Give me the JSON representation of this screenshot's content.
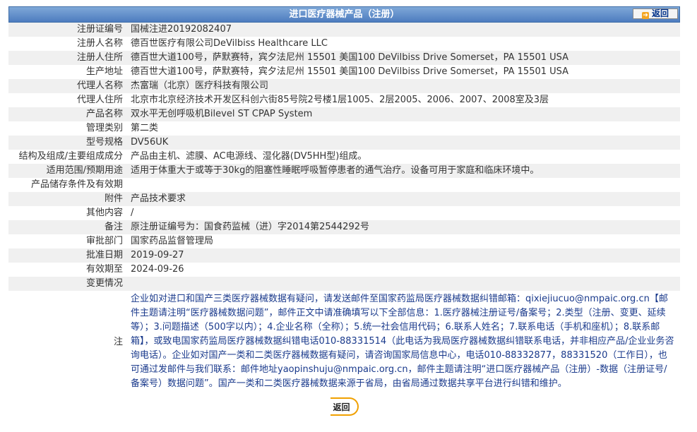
{
  "header": {
    "title": "进口医疗器械产品（注册）",
    "back_label": "返回"
  },
  "rows": [
    {
      "label": "注册证编号",
      "value": "国械注进20192082407"
    },
    {
      "label": "注册人名称",
      "value": "德百世医疗有限公司DeVilbiss Healthcare LLC"
    },
    {
      "label": "注册人住所",
      "value": "德百世大道100号，萨默赛特，宾夕法尼州 15501 美国100 DeVilbiss Drive Somerset，PA 15501 USA"
    },
    {
      "label": "生产地址",
      "value": "德百世大道100号，萨默赛特，宾夕法尼州 15501 美国100 DeVilbiss Drive Somerset，PA 15501 USA"
    },
    {
      "label": "代理人名称",
      "value": "杰富瑞（北京）医疗科技有限公司"
    },
    {
      "label": "代理人住所",
      "value": "北京市北京经济技术开发区科创六街85号院2号楼1层1005、2层2005、2006、2007、2008室及3层"
    },
    {
      "label": "产品名称",
      "value": "双水平无创呼吸机Bilevel ST CPAP System"
    },
    {
      "label": "管理类别",
      "value": "第二类"
    },
    {
      "label": "型号规格",
      "value": "DV56UK"
    },
    {
      "label": "结构及组成/主要组成成分",
      "value": "产品由主机、滤膜、AC电源线、湿化器(DV5HH型)组成。"
    },
    {
      "label": "适用范围/预期用途",
      "value": "适用于体重大于或等于30kg的阻塞性睡眠呼吸暂停患者的通气治疗。设备可用于家庭和临床环境中。"
    },
    {
      "label": "产品储存条件及有效期",
      "value": ""
    },
    {
      "label": "附件",
      "value": "产品技术要求"
    },
    {
      "label": "其他内容",
      "value": "/"
    },
    {
      "label": "备注",
      "value": "原注册证编号为：国食药监械（进）字2014第2544292号"
    },
    {
      "label": "审批部门",
      "value": "国家药品监督管理局"
    },
    {
      "label": "批准日期",
      "value": "2019-09-27"
    },
    {
      "label": "有效期至",
      "value": "2024-09-26"
    },
    {
      "label": "变更情况",
      "value": ""
    }
  ],
  "note": {
    "label": "注",
    "text": "企业如对进口和国产三类医疗器械数据有疑问，请发送邮件至国家药监局医疗器械数据纠错邮箱：qixiejiucuo@nmpaic.org.cn【邮件主题请注明“医疗器械数据问题”，邮件正文中请准确填写以下全部信息：1.医疗器械注册证号/备案号；2.类型（注册、变更、延续等）；3.问题描述（500字以内）；4.企业名称（全称）；5.统一社会信用代码；6.联系人姓名；7.联系电话（手机和座机）；8.联系邮箱】，或致电国家药监局医疗器械数据纠错电话010-88331514（此电话为我局医疗器械数据纠错联系电话，并非相应产品/企业业务咨询电话）。企业如对国产一类和二类医疗器械数据有疑问，请咨询国家局信息中心，电话010-88332877，88331520（工作日），也可通过发邮件与我们联系：邮件地址yaopinshuju@nmpaic.org.cn，邮件主题请注明“进口医疗器械产品（注册）-数据（注册证号/备案号）数据问题”。国产一类和二类医疗器械数据来源于省局，由省局通过数据共享平台进行纠错和维护。"
  },
  "footer": {
    "back_label": "返回"
  },
  "colors": {
    "header_bg": "#4d7cbf",
    "row_alt": "#f0f0f0",
    "note_text": "#1a3a8c",
    "back_ring": "#f0a000"
  }
}
